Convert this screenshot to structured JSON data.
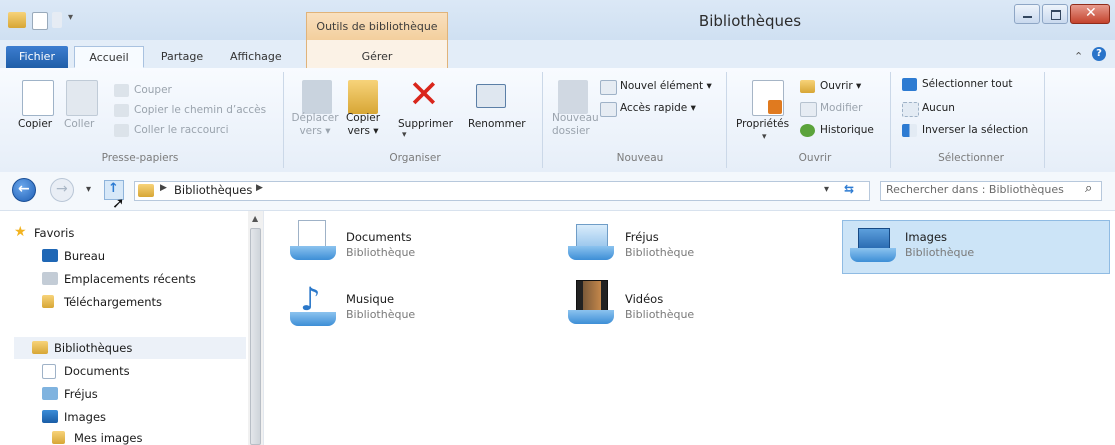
{
  "window": {
    "title": "Bibliothèques",
    "context_tab_header": "Outils de bibliothèque"
  },
  "tabs": {
    "fichier": "Fichier",
    "accueil": "Accueil",
    "partage": "Partage",
    "affichage": "Affichage",
    "gerer": "Gérer"
  },
  "ribbon": {
    "presse_papiers": {
      "label": "Presse-papiers",
      "copier": "Copier",
      "coller": "Coller",
      "couper": "Couper",
      "copier_chemin": "Copier le chemin d’accès",
      "coller_raccourci": "Coller le raccourci"
    },
    "organiser": {
      "label": "Organiser",
      "deplacer_line1": "Déplacer",
      "deplacer_line2": "vers",
      "copier_line1": "Copier",
      "copier_line2": "vers",
      "supprimer": "Supprimer",
      "renommer": "Renommer"
    },
    "nouveau": {
      "label": "Nouveau",
      "nouveau_dossier_line1": "Nouveau",
      "nouveau_dossier_line2": "dossier",
      "nouvel_element": "Nouvel élément",
      "acces_rapide": "Accès rapide"
    },
    "ouvrir": {
      "label": "Ouvrir",
      "proprietes": "Propriétés",
      "ouvrir": "Ouvrir",
      "modifier": "Modifier",
      "historique": "Historique"
    },
    "selectionner": {
      "label": "Sélectionner",
      "tout": "Sélectionner tout",
      "aucun": "Aucun",
      "inverser": "Inverser la sélection"
    }
  },
  "address": {
    "crumb": "Bibliothèques",
    "search_placeholder": "Rechercher dans : Bibliothèques"
  },
  "nav": {
    "favoris": "Favoris",
    "bureau": "Bureau",
    "recents": "Emplacements récents",
    "telechargements": "Téléchargements",
    "bibliotheques": "Bibliothèques",
    "documents": "Documents",
    "frejus": "Fréjus",
    "images": "Images",
    "mes_images": "Mes images"
  },
  "libraries": [
    {
      "name": "Documents",
      "type": "Bibliothèque"
    },
    {
      "name": "Fréjus",
      "type": "Bibliothèque"
    },
    {
      "name": "Images",
      "type": "Bibliothèque"
    },
    {
      "name": "Musique",
      "type": "Bibliothèque"
    },
    {
      "name": "Vidéos",
      "type": "Bibliothèque"
    }
  ],
  "colors": {
    "accent": "#1f5ea8",
    "selection": "#cce4f7",
    "context_tab": "#f3cf9d"
  }
}
